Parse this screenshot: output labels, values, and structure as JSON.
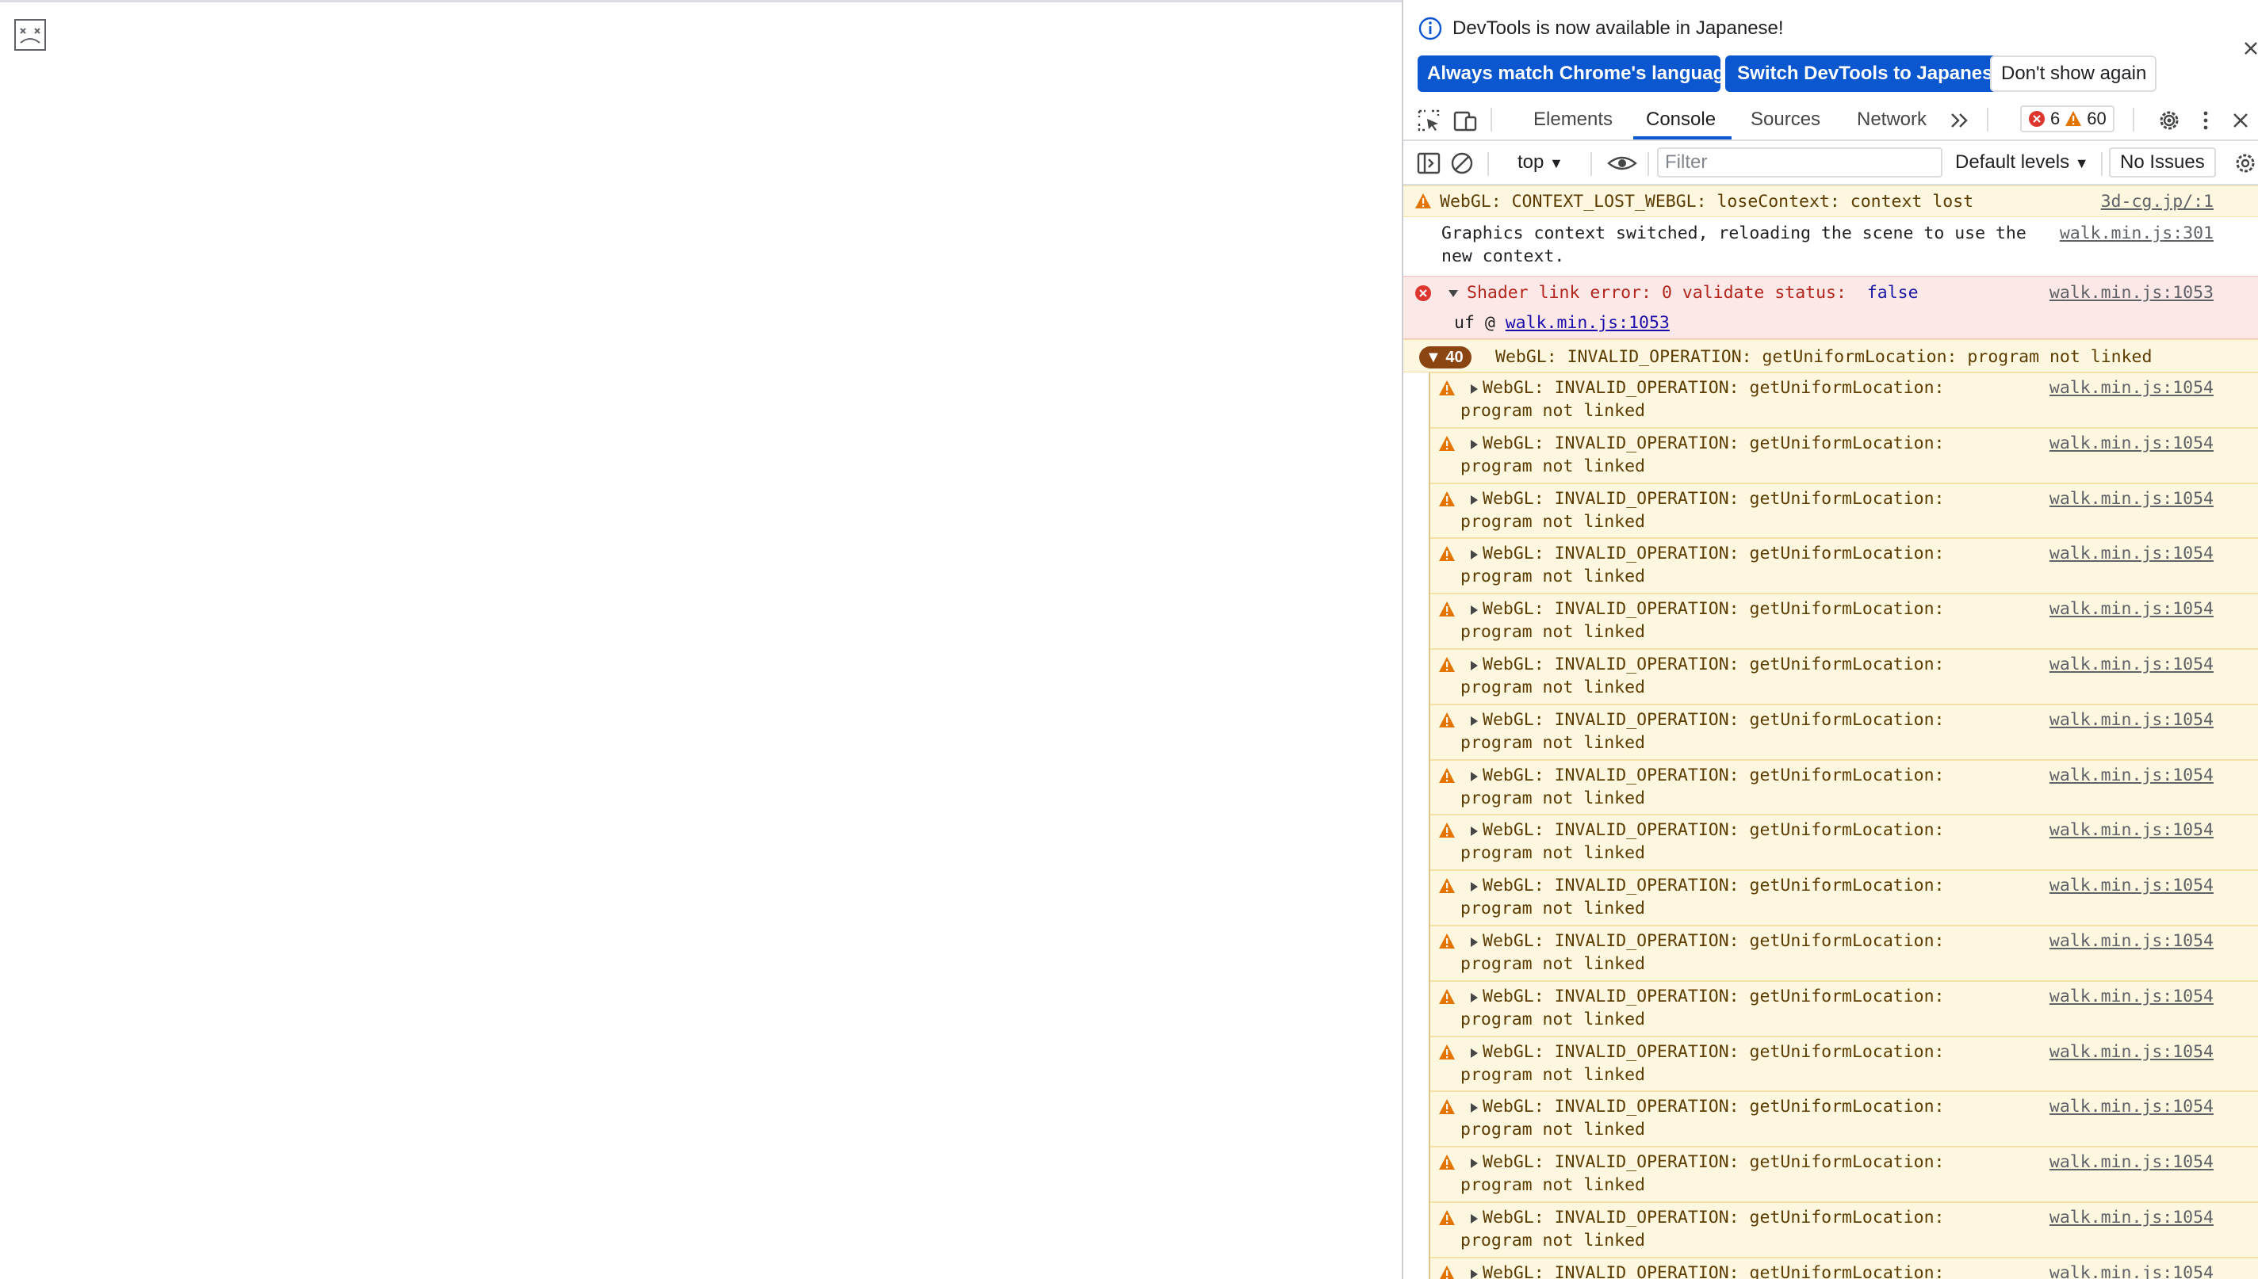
{
  "infobar": {
    "message": "DevTools is now available in Japanese!",
    "buttons": {
      "always_match": "Always match Chrome's language",
      "switch": "Switch DevTools to Japanese",
      "dont_show": "Don't show again"
    }
  },
  "tabs": {
    "elements": "Elements",
    "console": "Console",
    "sources": "Sources",
    "network": "Network"
  },
  "counts": {
    "errors": "6",
    "warnings": "60"
  },
  "console_toolbar": {
    "context": "top",
    "filter_placeholder": "Filter",
    "levels": "Default levels",
    "issues": "No Issues"
  },
  "messages": {
    "m1": {
      "text": "WebGL: CONTEXT_LOST_WEBGL: loseContext: context lost",
      "source": "3d-cg.jp/:1"
    },
    "m2": {
      "line1": "Graphics context switched, reloading the scene to use the",
      "line2": "new context.",
      "source": "walk.min.js:301"
    },
    "m3": {
      "text": "Shader link error: 0 validate status:",
      "value": "false",
      "source": "walk.min.js:1053",
      "stack_prefix": "uf @ ",
      "stack_link": "walk.min.js:1053"
    },
    "group": {
      "count": "40",
      "text": "WebGL: INVALID_OPERATION: getUniformLocation: program not linked"
    },
    "repeat": {
      "line1": "WebGL: INVALID_OPERATION: getUniformLocation:",
      "line2": "program not linked",
      "source": "walk.min.js:1054",
      "partial_line": "WebGL: INVALID_OPERATION: getUniformLocation:"
    }
  }
}
